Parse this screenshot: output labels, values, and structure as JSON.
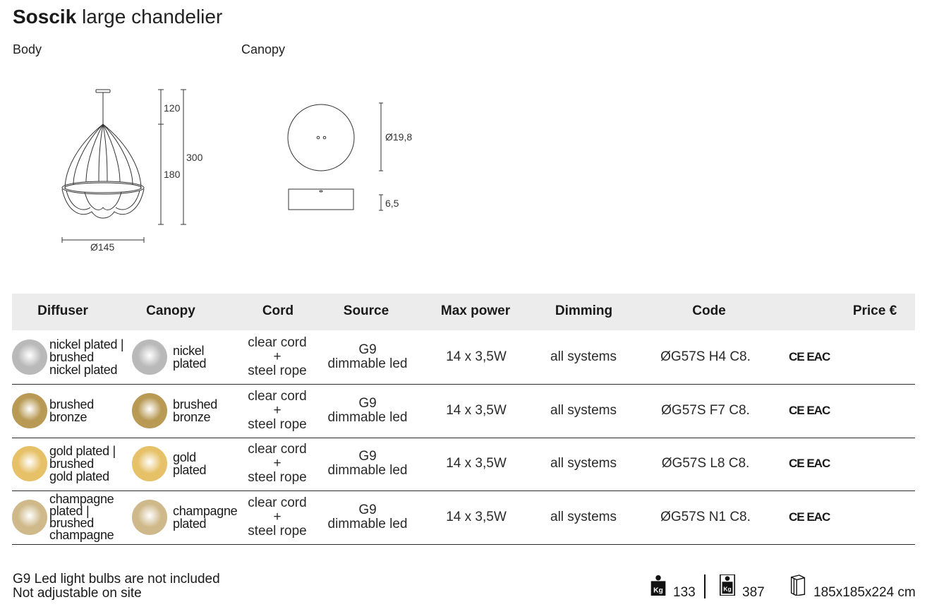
{
  "header": {
    "title_bold": "Soscik",
    "title_light": "large chandelier"
  },
  "sections": {
    "body_label": "Body",
    "canopy_label": "Canopy"
  },
  "drawing": {
    "body_dims": {
      "top": "120",
      "middle": "180",
      "total": "300",
      "diameter": "Ø145"
    },
    "canopy_dims": {
      "diameter": "Ø19,8",
      "height": "6,5"
    }
  },
  "table": {
    "headers": [
      "Diffuser",
      "Canopy",
      "Cord",
      "Source",
      "Max power",
      "Dimming",
      "Code",
      "Price €"
    ],
    "rows": [
      {
        "diffuser": [
          "nickel plated |",
          "brushed",
          "nickel plated"
        ],
        "canopy": [
          "nickel",
          "plated"
        ],
        "cord": [
          "clear cord",
          "+",
          "steel rope"
        ],
        "source": [
          "G9",
          "dimmable led"
        ],
        "power": "14 x 3,5W",
        "dimming": "all systems",
        "code": "ØG57S H4 C8.",
        "cert": "CE EAC",
        "color": "#b9b9b9"
      },
      {
        "diffuser": [
          "brushed",
          "bronze"
        ],
        "canopy": [
          "brushed",
          "bronze"
        ],
        "cord": [
          "clear cord",
          "+",
          "steel rope"
        ],
        "source": [
          "G9",
          "dimmable led"
        ],
        "power": "14 x 3,5W",
        "dimming": "all systems",
        "code": "ØG57S F7 C8.",
        "cert": "CE EAC",
        "color": "#b89a55"
      },
      {
        "diffuser": [
          "gold plated |",
          "brushed",
          "gold plated"
        ],
        "canopy": [
          "gold",
          "plated"
        ],
        "cord": [
          "clear cord",
          "+",
          "steel rope"
        ],
        "source": [
          "G9",
          "dimmable led"
        ],
        "power": "14 x 3,5W",
        "dimming": "all systems",
        "code": "ØG57S L8 C8.",
        "cert": "CE EAC",
        "color": "#e6c168"
      },
      {
        "diffuser": [
          "champagne",
          "plated |",
          "brushed",
          "champagne"
        ],
        "canopy": [
          "champagne",
          "plated"
        ],
        "cord": [
          "clear cord",
          "+",
          "steel rope"
        ],
        "source": [
          "G9",
          "dimmable led"
        ],
        "power": "14 x 3,5W",
        "dimming": "all systems",
        "code": "ØG57S N1 C8.",
        "cert": "CE EAC",
        "color": "#cfb98a"
      }
    ]
  },
  "footer": {
    "note1": "G9 Led light bulbs are not included",
    "note2": "Not adjustable on site",
    "net_weight": "133",
    "gross_weight": "387",
    "package_dims": "185x185x224 cm",
    "weight_icon_label": "Kg"
  }
}
